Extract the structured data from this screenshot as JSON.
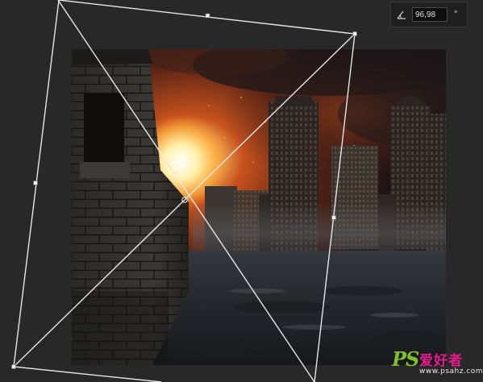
{
  "transform": {
    "angle_value": "96,98",
    "angle_unit": "°",
    "icon": "angle-icon"
  },
  "watermark": {
    "brand": "PS",
    "chinese": "爱好者",
    "url": "www.psahz.com"
  },
  "colors": {
    "background": "#282828",
    "bounding_box": "#e6e6e6",
    "watermark_green": "#7fbf2a",
    "watermark_pink": "#e61c8c"
  }
}
